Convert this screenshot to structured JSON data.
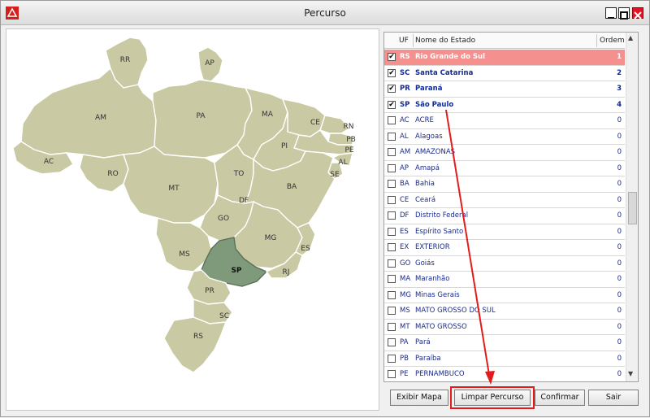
{
  "window": {
    "title": "Percurso"
  },
  "colors": {
    "selected_state": "#7f9a7a",
    "state_fill": "#c9c9a3",
    "highlight_row": "#f4908d",
    "annotation_red": "#e31b1b"
  },
  "map": {
    "labels": {
      "RR": "RR",
      "AP": "AP",
      "AM": "AM",
      "PA": "PA",
      "MA": "MA",
      "CE": "CE",
      "RN": "RN",
      "PB": "PB",
      "PE": "PE",
      "AL": "AL",
      "SE": "SE",
      "PI": "PI",
      "AC": "AC",
      "RO": "RO",
      "MT": "MT",
      "TO": "TO",
      "BA": "BA",
      "DF": "DF",
      "GO": "GO",
      "MG": "MG",
      "ES": "ES",
      "MS": "MS",
      "SP": "SP",
      "RJ": "RJ",
      "PR": "PR",
      "SC": "SC",
      "RS": "RS"
    },
    "selected": "SP"
  },
  "grid": {
    "headers": {
      "uf": "UF",
      "nome": "Nome do Estado",
      "ordem": "Ordem"
    },
    "rows": [
      {
        "checked": true,
        "uf": "RS",
        "nome": "Rio Grande do Sul",
        "ordem": "1",
        "state": "highlight"
      },
      {
        "checked": true,
        "uf": "SC",
        "nome": "Santa Catarina",
        "ordem": "2",
        "state": "selected"
      },
      {
        "checked": true,
        "uf": "PR",
        "nome": "Paraná",
        "ordem": "3",
        "state": "selected"
      },
      {
        "checked": true,
        "uf": "SP",
        "nome": "São Paulo",
        "ordem": "4",
        "state": "selected"
      },
      {
        "checked": false,
        "uf": "AC",
        "nome": "ACRE",
        "ordem": "0",
        "state": ""
      },
      {
        "checked": false,
        "uf": "AL",
        "nome": "Alagoas",
        "ordem": "0",
        "state": ""
      },
      {
        "checked": false,
        "uf": "AM",
        "nome": "AMAZONAS",
        "ordem": "0",
        "state": ""
      },
      {
        "checked": false,
        "uf": "AP",
        "nome": "Amapá",
        "ordem": "0",
        "state": ""
      },
      {
        "checked": false,
        "uf": "BA",
        "nome": "Bahia",
        "ordem": "0",
        "state": ""
      },
      {
        "checked": false,
        "uf": "CE",
        "nome": "Ceará",
        "ordem": "0",
        "state": ""
      },
      {
        "checked": false,
        "uf": "DF",
        "nome": "Distrito Federal",
        "ordem": "0",
        "state": ""
      },
      {
        "checked": false,
        "uf": "ES",
        "nome": "Espírito Santo",
        "ordem": "0",
        "state": ""
      },
      {
        "checked": false,
        "uf": "EX",
        "nome": "EXTERIOR",
        "ordem": "0",
        "state": ""
      },
      {
        "checked": false,
        "uf": "GO",
        "nome": "Goiás",
        "ordem": "0",
        "state": ""
      },
      {
        "checked": false,
        "uf": "MA",
        "nome": "Maranhão",
        "ordem": "0",
        "state": ""
      },
      {
        "checked": false,
        "uf": "MG",
        "nome": "Minas Gerais",
        "ordem": "0",
        "state": ""
      },
      {
        "checked": false,
        "uf": "MS",
        "nome": "MATO GROSSO DO SUL",
        "ordem": "0",
        "state": ""
      },
      {
        "checked": false,
        "uf": "MT",
        "nome": "MATO GROSSO",
        "ordem": "0",
        "state": ""
      },
      {
        "checked": false,
        "uf": "PA",
        "nome": "Pará",
        "ordem": "0",
        "state": ""
      },
      {
        "checked": false,
        "uf": "PB",
        "nome": "Paraíba",
        "ordem": "0",
        "state": ""
      },
      {
        "checked": false,
        "uf": "PE",
        "nome": "PERNAMBUCO",
        "ordem": "0",
        "state": ""
      }
    ]
  },
  "buttons": {
    "exibir_mapa": "Exibir Mapa",
    "limpar_percurso": "Limpar Percurso",
    "confirmar": "Confirmar",
    "sair": "Sair"
  }
}
